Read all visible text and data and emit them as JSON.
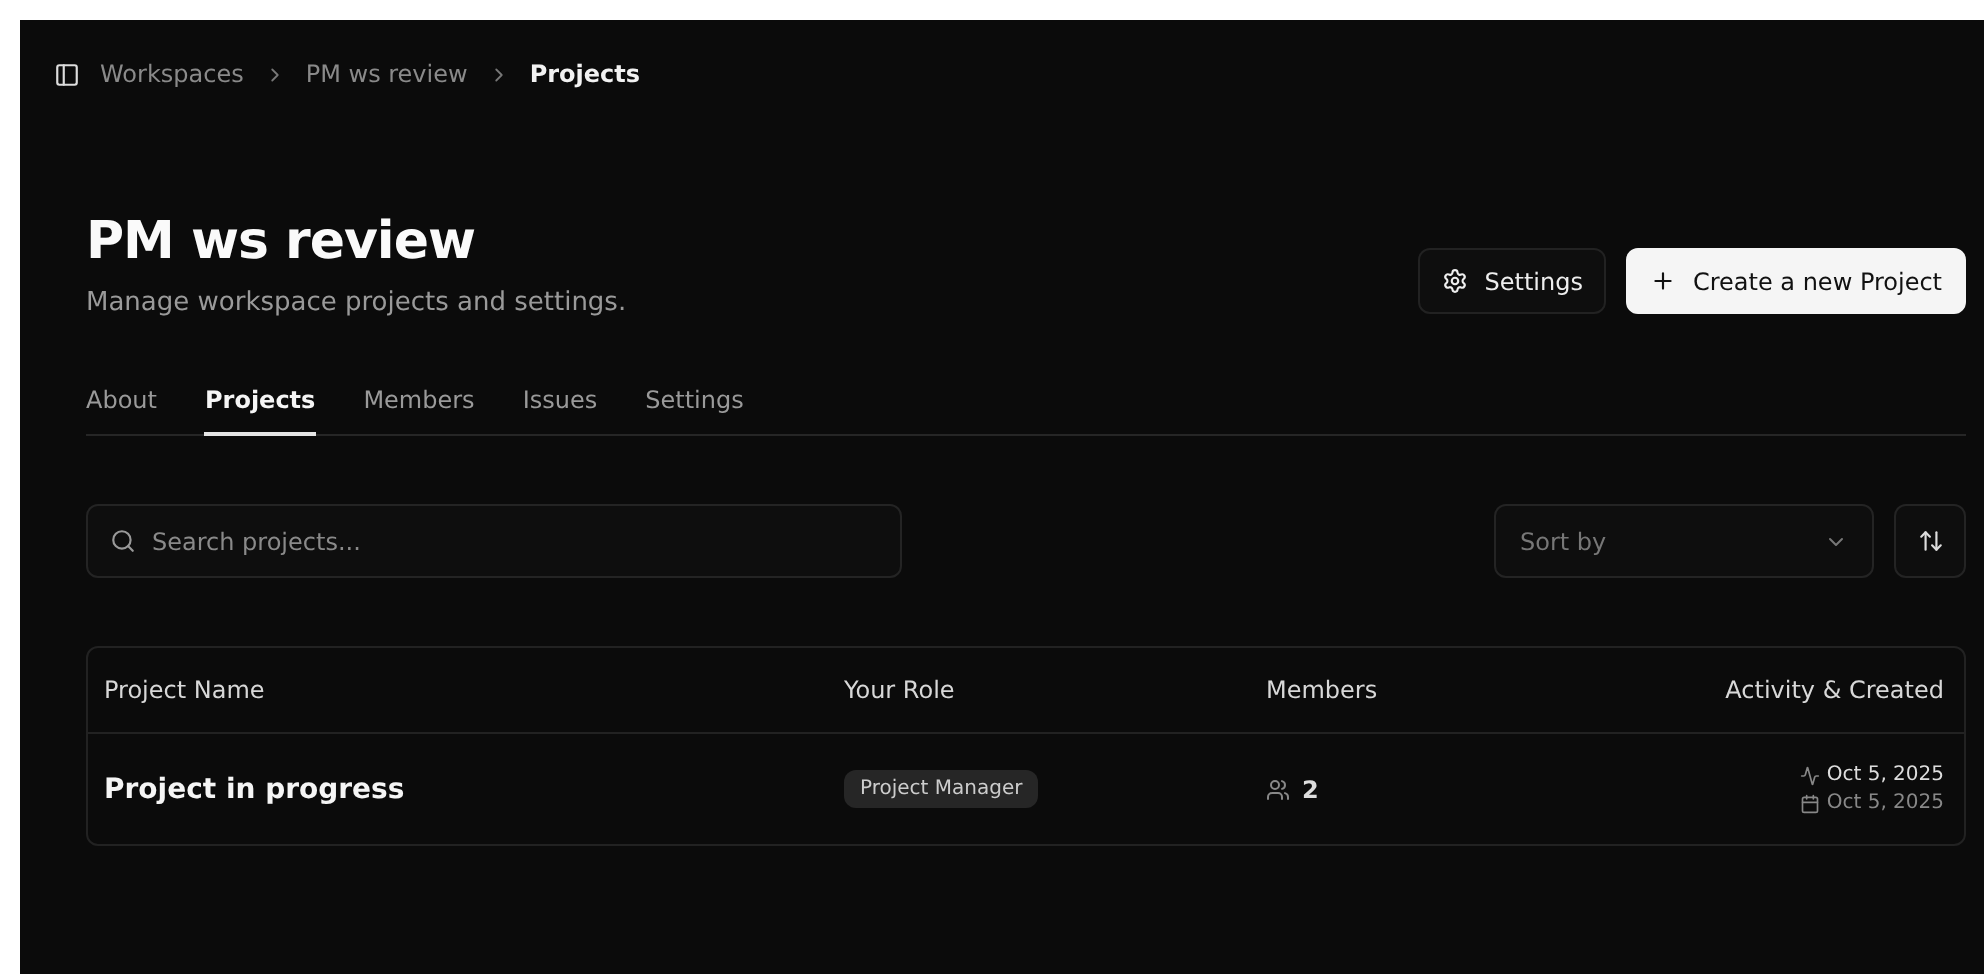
{
  "breadcrumb": [
    "Workspaces",
    "PM ws review",
    "Projects"
  ],
  "header": {
    "title": "PM ws review",
    "subtitle": "Manage workspace projects and settings.",
    "settings_button": "Settings",
    "create_button": "Create a new Project"
  },
  "tabs": [
    {
      "label": "About",
      "selected": false
    },
    {
      "label": "Projects",
      "selected": true
    },
    {
      "label": "Members",
      "selected": false
    },
    {
      "label": "Issues",
      "selected": false
    },
    {
      "label": "Settings",
      "selected": false
    }
  ],
  "search": {
    "placeholder": "Search projects..."
  },
  "sort": {
    "placeholder": "Sort by"
  },
  "table": {
    "columns": [
      "Project Name",
      "Your Role",
      "Members",
      "Activity & Created"
    ],
    "rows": [
      {
        "name": "Project in progress",
        "role": "Project Manager",
        "members": "2",
        "activity": "Oct 5, 2025",
        "created": "Oct 5, 2025"
      }
    ]
  }
}
